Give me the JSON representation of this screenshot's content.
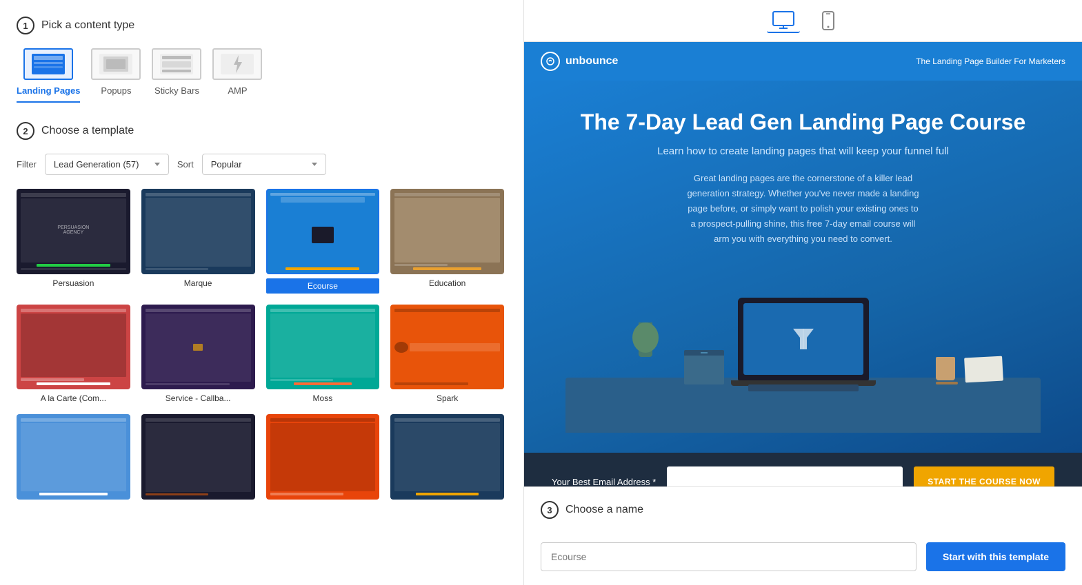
{
  "left": {
    "step1": {
      "number": "1",
      "title": "Pick a content type"
    },
    "content_types": [
      {
        "id": "landing-pages",
        "label": "Landing Pages",
        "active": true
      },
      {
        "id": "popups",
        "label": "Popups",
        "active": false
      },
      {
        "id": "sticky-bars",
        "label": "Sticky Bars",
        "active": false
      },
      {
        "id": "amp",
        "label": "AMP",
        "active": false
      }
    ],
    "step2": {
      "number": "2",
      "title": "Choose a template"
    },
    "filter": {
      "label": "Filter",
      "value": "Lead Generation (57)"
    },
    "sort": {
      "label": "Sort",
      "value": "Popular"
    },
    "templates": [
      {
        "id": "persuasion",
        "name": "Persuasion",
        "selected": false,
        "bg": "#1a1a2e"
      },
      {
        "id": "marque",
        "name": "Marque",
        "selected": false,
        "bg": "#1a3a5c"
      },
      {
        "id": "ecourse",
        "name": "Ecourse",
        "selected": true,
        "bg": "#1a7fd4"
      },
      {
        "id": "education",
        "name": "Education",
        "selected": false,
        "bg": "#8b7355"
      },
      {
        "id": "alacarte",
        "name": "A la Carte (Com...",
        "selected": false,
        "bg": "#cc4444"
      },
      {
        "id": "service",
        "name": "Service - Callba...",
        "selected": false,
        "bg": "#2d1b4e"
      },
      {
        "id": "moss",
        "name": "Moss",
        "selected": false,
        "bg": "#00a896"
      },
      {
        "id": "spark",
        "name": "Spark",
        "selected": false,
        "bg": "#e8540a"
      },
      {
        "id": "row3a",
        "name": "",
        "selected": false,
        "bg": "#4a90d9"
      },
      {
        "id": "row3b",
        "name": "",
        "selected": false,
        "bg": "#1a1a2e"
      },
      {
        "id": "row3c",
        "name": "",
        "selected": false,
        "bg": "#e8440a"
      },
      {
        "id": "row3d",
        "name": "",
        "selected": false,
        "bg": "#1a3a5c"
      }
    ]
  },
  "right": {
    "device_toggle": {
      "desktop_label": "Desktop",
      "mobile_label": "Mobile"
    },
    "preview": {
      "nav": {
        "logo_text": "unbounce",
        "tagline": "The Landing Page Builder For Marketers"
      },
      "hero": {
        "title": "The 7-Day Lead Gen Landing Page Course",
        "subtitle": "Learn how to create landing pages that will keep your funnel full",
        "body": "Great landing pages are the cornerstone of a killer lead generation strategy. Whether you've never made a landing page before, or simply want to polish your existing ones to a prospect-pulling shine, this free 7-day email course will arm you with everything you need to convert."
      },
      "cta": {
        "label": "Your Best Email Address *",
        "input_placeholder": "",
        "button_text": "START THE COURSE NOW"
      }
    },
    "step3": {
      "number": "3",
      "title": "Choose a name"
    },
    "name_input": {
      "placeholder": "Ecourse"
    },
    "start_button": "Start with this template"
  }
}
